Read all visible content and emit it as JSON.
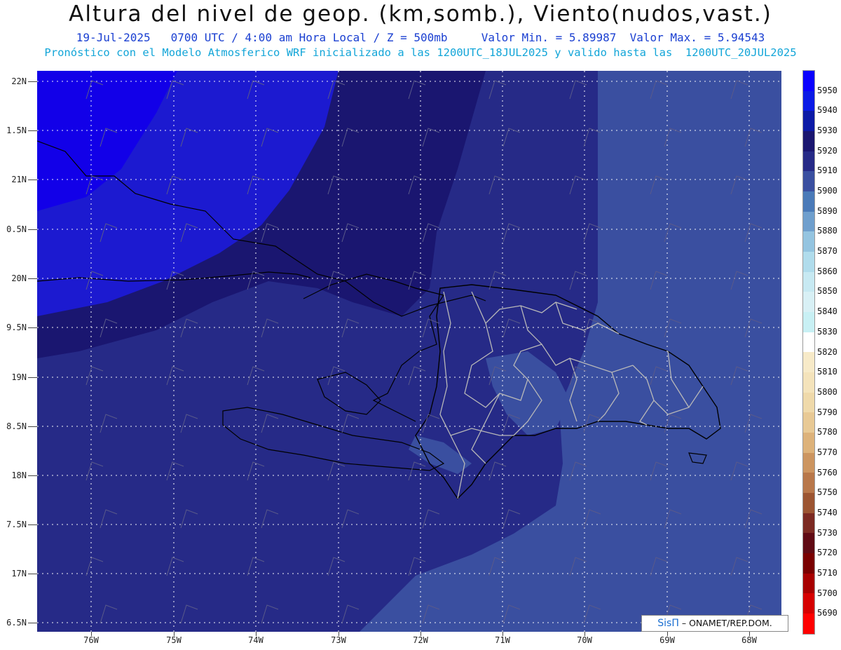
{
  "header": {
    "title": "Altura del nivel de geop. (km,somb.), Viento(nudos,vast.)",
    "line2": "19-Jul-2025   0700 UTC / 4:00 am Hora Local / Z = 500mb     Valor Min. = 5.89987  Valor Max. = 5.94543",
    "line3": "Pronóstico con el Modelo Atmosferico WRF inicializado a las 1200UTC_18JUL2025 y valido hasta las  1200UTC_20JUL2025"
  },
  "axes": {
    "lat_labels": [
      "22N",
      "1.5N",
      "21N",
      "0.5N",
      "20N",
      "9.5N",
      "19N",
      "8.5N",
      "18N",
      "7.5N",
      "17N",
      "6.5N"
    ],
    "lon_labels": [
      "76W",
      "75W",
      "74W",
      "73W",
      "72W",
      "71W",
      "70W",
      "69W",
      "68W"
    ]
  },
  "colorbar": {
    "labels": [
      "5950",
      "5940",
      "5930",
      "5920",
      "5910",
      "5900",
      "5890",
      "5880",
      "5870",
      "5860",
      "5850",
      "5840",
      "5830",
      "5820",
      "5810",
      "5800",
      "5790",
      "5780",
      "5770",
      "5760",
      "5750",
      "5740",
      "5730",
      "5720",
      "5710",
      "5700",
      "5690"
    ],
    "colors": [
      "#0a00ff",
      "#0a1ae6",
      "#0c1aa6",
      "#1a1670",
      "#262a87",
      "#3a4fa0",
      "#4a7ab8",
      "#6f9fcd",
      "#94c4e0",
      "#b0dcec",
      "#c7e9f2",
      "#d8f0f5",
      "#c8f0f4",
      "#ffffff",
      "#f7eac8",
      "#f4e3bb",
      "#efd9aa",
      "#e8c995",
      "#ddb27a",
      "#cc9560",
      "#b8774a",
      "#9c5532",
      "#7c2a22",
      "#600a14",
      "#7a0000",
      "#a80000",
      "#d60000",
      "#ff0000"
    ],
    "map_colors": {
      "deep": "#1200e8",
      "blue": "#1c1ad0",
      "navy": "#1a1670",
      "indigo": "#262a87",
      "steel": "#3a4fa0",
      "light": "#5a7fbf"
    }
  },
  "credit": {
    "logo": "SisΠ",
    "text": "– ONAMET/REP.DOM."
  }
}
